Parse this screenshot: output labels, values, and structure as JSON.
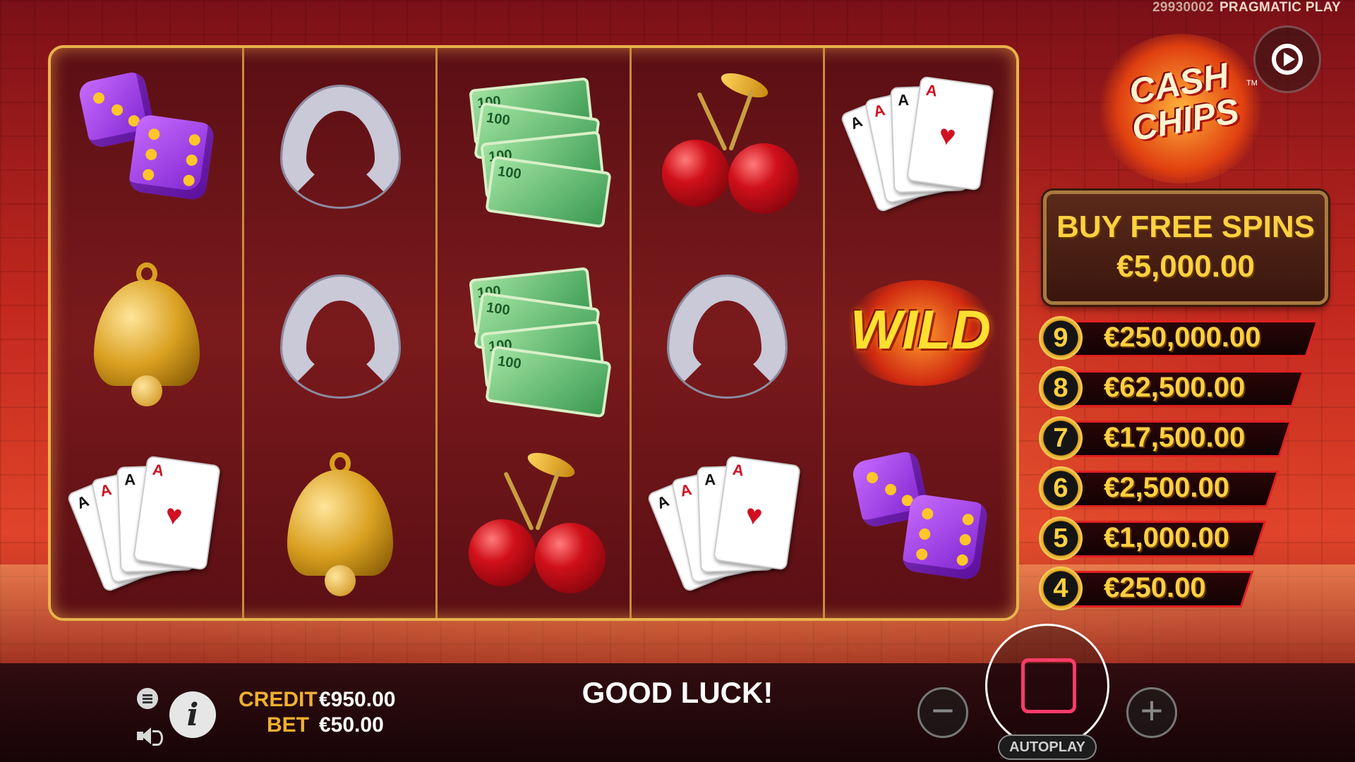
{
  "header": {
    "game_id": "29930002",
    "provider": "PRAGMATIC PLAY"
  },
  "logo": {
    "line1": "CASH",
    "line2": "CHIPS",
    "tm": "TM"
  },
  "buy_free_spins": {
    "title": "BUY FREE SPINS",
    "price": "€5,000.00"
  },
  "paytable": [
    {
      "count": "9",
      "value": "€250,000.00"
    },
    {
      "count": "8",
      "value": "€62,500.00"
    },
    {
      "count": "7",
      "value": "€17,500.00"
    },
    {
      "count": "6",
      "value": "€2,500.00"
    },
    {
      "count": "5",
      "value": "€1,000.00"
    },
    {
      "count": "4",
      "value": "€250.00"
    }
  ],
  "reels": [
    [
      "dice",
      "bell",
      "cards"
    ],
    [
      "horseshoe",
      "horseshoe",
      "bell"
    ],
    [
      "money",
      "money",
      "cherries"
    ],
    [
      "cherries",
      "horseshoe",
      "cards"
    ],
    [
      "cards",
      "wild",
      "dice"
    ]
  ],
  "symbols": {
    "wild_label": "WILD",
    "bill_label": "100"
  },
  "bottom": {
    "credit_label": "CREDIT",
    "credit_value": "€950.00",
    "bet_label": "BET",
    "bet_value": "€50.00",
    "message": "GOOD LUCK!",
    "minus": "−",
    "plus": "+",
    "autoplay": "AUTOPLAY",
    "info": "i"
  },
  "colors": {
    "accent_gold": "#ffd040",
    "stop_red": "#ff3b6a",
    "frame_gold": "#e8b34a"
  }
}
